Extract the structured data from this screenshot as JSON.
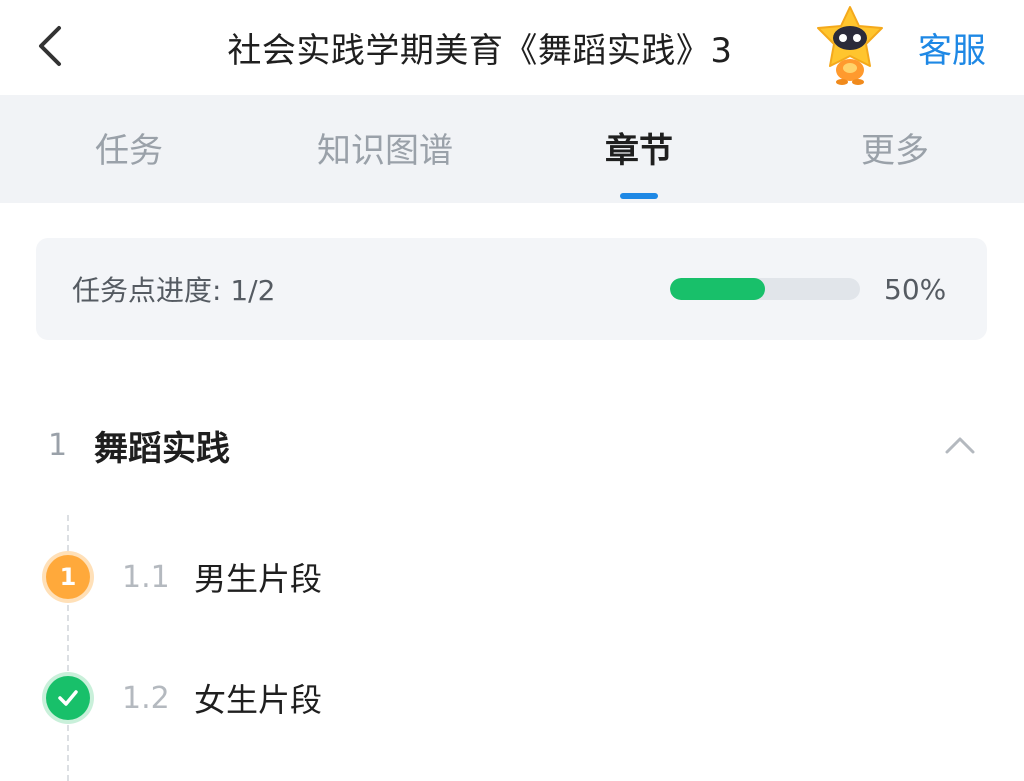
{
  "header": {
    "back_icon": "chevron-left-icon",
    "title": "社会实践学期美育《舞蹈实践》3",
    "mascot_icon": "star-robot-mascot-icon",
    "service_label": "客服",
    "accent_color": "#1e88e5"
  },
  "tabs": [
    {
      "label": "任务",
      "active": false
    },
    {
      "label": "知识图谱",
      "active": false
    },
    {
      "label": "章节",
      "active": true
    },
    {
      "label": "更多",
      "active": false
    }
  ],
  "progress": {
    "label": "任务点进度: 1/2",
    "completed": 1,
    "total": 2,
    "fraction": 0.5,
    "percent_text": "50%",
    "fill_color": "#18c06a"
  },
  "chapter": {
    "number": "1",
    "title": "舞蹈实践",
    "expanded": true,
    "toggle_icon": "chevron-up-icon",
    "sections": [
      {
        "status": "pending",
        "badge_text": "1",
        "badge_color": "#ffa93b",
        "number": "1.1",
        "title": "男生片段"
      },
      {
        "status": "done",
        "badge_icon": "check-icon",
        "badge_color": "#18c06a",
        "number": "1.2",
        "title": "女生片段"
      }
    ]
  }
}
